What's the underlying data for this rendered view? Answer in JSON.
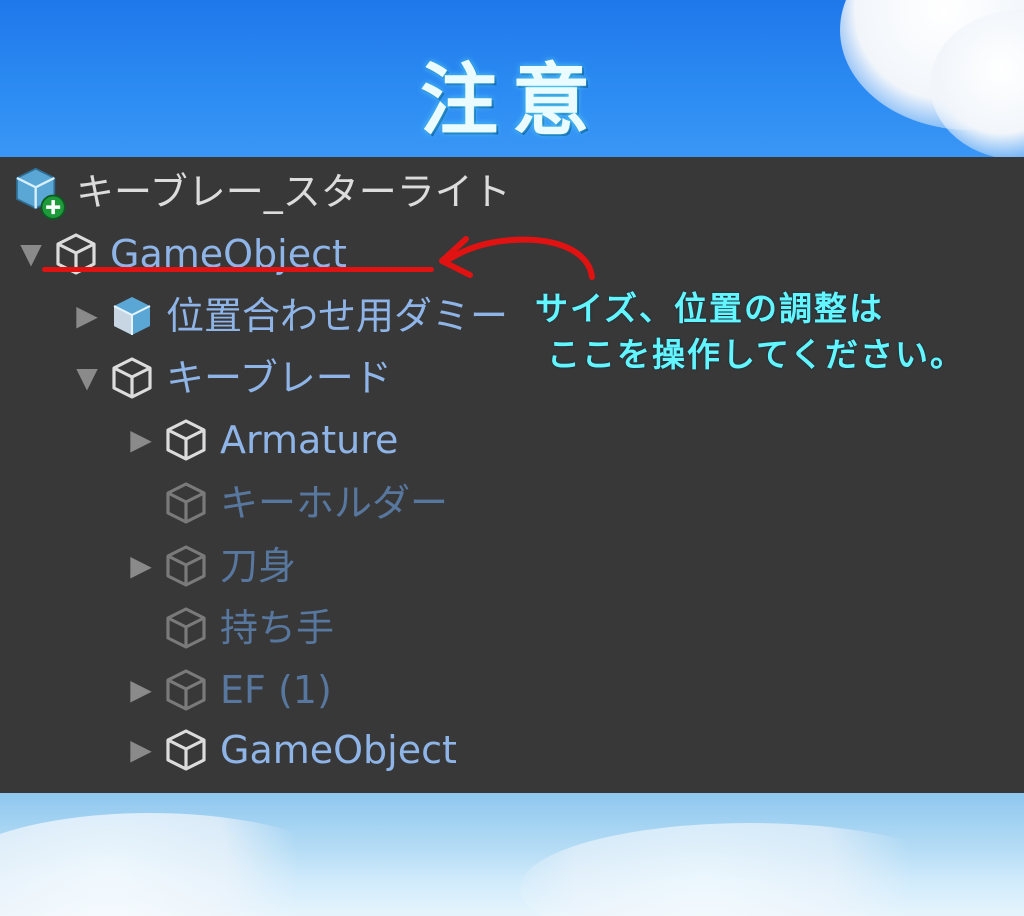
{
  "banner": {
    "title": "注意"
  },
  "hierarchy": {
    "root": {
      "label": "キーブレー_スターライト",
      "icon": "prefab-add-icon"
    },
    "items": [
      {
        "label": "GameObject",
        "expanded": true,
        "icon": "gameobject-cube-icon"
      },
      {
        "label": "位置合わせ用ダミー",
        "expanded": false,
        "icon": "prefab-cube-icon"
      },
      {
        "label": "キーブレード",
        "expanded": true,
        "icon": "gameobject-cube-icon"
      },
      {
        "label": "Armature",
        "expanded": false,
        "icon": "gameobject-cube-icon"
      },
      {
        "label": "キーホルダー",
        "inactive": true,
        "icon": "gameobject-cube-icon"
      },
      {
        "label": "刀身",
        "expanded": false,
        "inactive": true,
        "icon": "gameobject-cube-icon"
      },
      {
        "label": "持ち手",
        "inactive": true,
        "icon": "gameobject-cube-icon"
      },
      {
        "label": "EF (1)",
        "expanded": false,
        "inactive": true,
        "icon": "gameobject-cube-icon"
      },
      {
        "label": "GameObject",
        "expanded": false,
        "icon": "gameobject-cube-icon"
      }
    ]
  },
  "annotation": {
    "line1": "サイズ、位置の調整は",
    "line2": "ここを操作してください。",
    "arrow_color": "#e01212",
    "text_color": "#64f6ff"
  }
}
